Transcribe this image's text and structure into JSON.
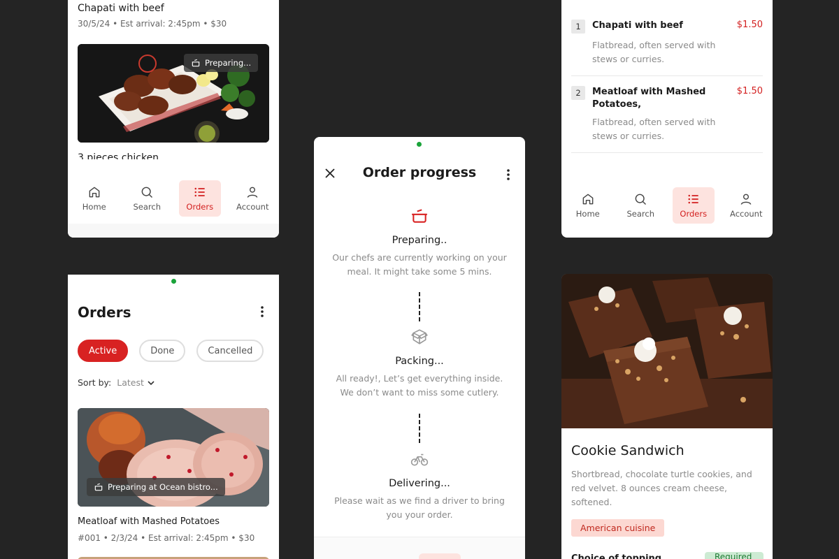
{
  "colors": {
    "accent": "#d82222",
    "accent_soft": "#fde3df",
    "background": "#242424"
  },
  "nav": {
    "home": "Home",
    "search": "Search",
    "orders": "Orders",
    "account": "Account",
    "active_item": "orders"
  },
  "top_left": {
    "order1": {
      "title": "Chapati with beef",
      "meta": "30/5/24  •  Est arrival: 2:45pm  •  $30",
      "status": "Preparing..."
    },
    "order2_title": "3 pieces chicken"
  },
  "orders_screen": {
    "title": "Orders",
    "filters": [
      "Active",
      "Done",
      "Cancelled"
    ],
    "active_filter": "Active",
    "sort_label": "Sort by:",
    "sort_value": "Latest",
    "order": {
      "status": "Preparing at Ocean bistro...",
      "title": "Meatloaf with Mashed Potatoes",
      "meta": "#001  •  2/3/24  •  Est arrival: 2:45pm  •  $30"
    }
  },
  "progress": {
    "title": "Order progress",
    "steps": [
      {
        "icon": "pot-icon",
        "title": "Preparing..",
        "desc": "Our chefs are currently working on your meal. It might take some 5 mins."
      },
      {
        "icon": "box-icon",
        "title": "Packing...",
        "desc": "All ready!, Let’s get everything inside. We don’t want to miss some cutlery."
      },
      {
        "icon": "bike-icon",
        "title": "Delivering...",
        "desc": "Please wait as we find a driver to bring you your order."
      }
    ]
  },
  "menu_list": {
    "items": [
      {
        "num": "1",
        "name": "Chapati with beef",
        "price": "$1.50",
        "desc": "Flatbread, often served with stews or curries."
      },
      {
        "num": "2",
        "name": "Meatloaf with Mashed Potatoes,",
        "price": "$1.50",
        "desc": "Flatbread, often served with stews or curries."
      }
    ]
  },
  "product": {
    "title": "Cookie Sandwich",
    "desc": "Shortbread, chocolate turtle cookies, and red velvet. 8 ounces cream cheese, softened.",
    "tag": "American cuisine",
    "sub_heading": "Choice of topping",
    "badge": "Required"
  }
}
